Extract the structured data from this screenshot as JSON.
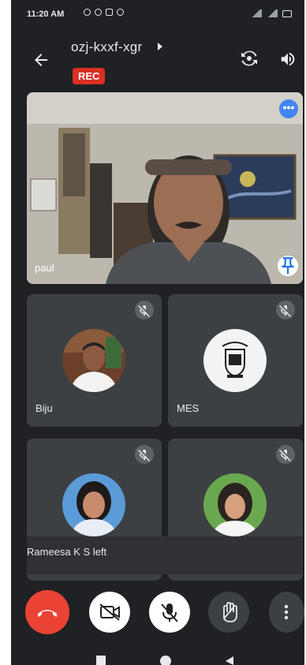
{
  "status_bar": {
    "time": "11:20 AM"
  },
  "meeting": {
    "code": "ozj-kxxf-xgr",
    "rec_badge": "REC"
  },
  "main_participant": {
    "name": "paul"
  },
  "participants": [
    {
      "name": "Biju",
      "muted": true
    },
    {
      "name": "MES",
      "muted": true
    },
    {
      "name": "",
      "muted": true
    },
    {
      "name": "",
      "muted": true
    }
  ],
  "notice": "Rameesa K S left",
  "colors": {
    "end_call": "#ea4335",
    "rec": "#d93025",
    "accent": "#4285f4",
    "background": "#202124",
    "tile": "#3c4043"
  },
  "controls": [
    "end-call-icon",
    "camera-off-icon",
    "mic-off-icon",
    "raise-hand-icon",
    "more-vert-icon"
  ]
}
